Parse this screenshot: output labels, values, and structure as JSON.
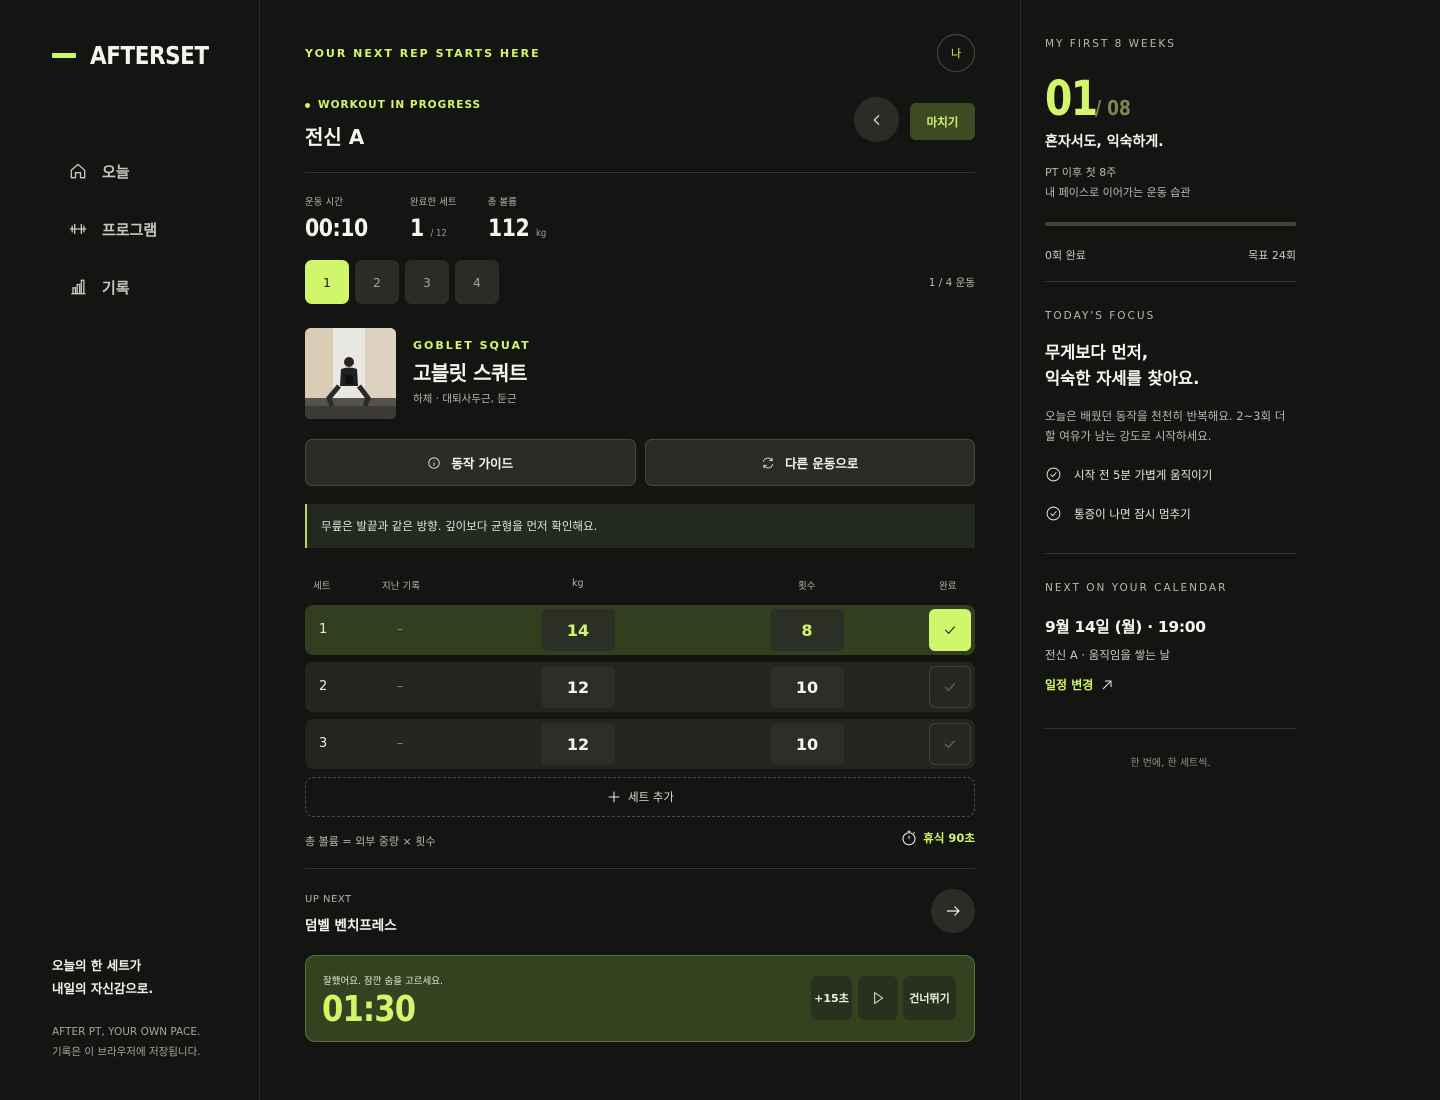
{
  "brand": {
    "name": "AFTERSET"
  },
  "colors": {
    "accent": "#d1f56b",
    "background": "#141512",
    "surface": "#2a2c27",
    "done_row": "#323f1f"
  },
  "sidebar": {
    "items": [
      {
        "label": "오늘",
        "icon": "home-icon"
      },
      {
        "label": "프로그램",
        "icon": "dumbbell-icon"
      },
      {
        "label": "기록",
        "icon": "bar-chart-icon"
      }
    ],
    "slogan_line1": "오늘의 한 세트가",
    "slogan_line2": "내일의 자신감으로.",
    "meta_line1": "AFTER PT, YOUR OWN PACE.",
    "meta_line2": "기록은 이 브라우저에 저장됩니다."
  },
  "header": {
    "tagline": "YOUR NEXT REP STARTS HERE",
    "avatar_label": "나"
  },
  "workout": {
    "status": "WORKOUT IN PROGRESS",
    "title": "전신 A",
    "finish_label": "마치기",
    "stats": [
      {
        "label": "운동 시간",
        "value": "00:10",
        "unit": ""
      },
      {
        "label": "완료한 세트",
        "value": "1",
        "unit": "/ 12"
      },
      {
        "label": "총 볼륨",
        "value": "112",
        "unit": "kg"
      }
    ],
    "exercise_tabs": [
      "1",
      "2",
      "3",
      "4"
    ],
    "active_tab": 1,
    "tab_count": "1 / 4 운동"
  },
  "exercise": {
    "name_en": "GOBLET SQUAT",
    "name_ko": "고블릿 스쿼트",
    "muscles": "하체 · 대퇴사두근, 둔근",
    "guide_label": "동작 가이드",
    "swap_label": "다른 운동으로",
    "tip": "무릎은 발끝과 같은 방향. 깊이보다 균형을 먼저 확인해요."
  },
  "sets": {
    "headers": {
      "set": "세트",
      "prev": "지난 기록",
      "kg": "kg",
      "reps": "횟수",
      "done": "완료"
    },
    "rows": [
      {
        "num": "1",
        "prev": "–",
        "kg": "14",
        "reps": "8",
        "done": true
      },
      {
        "num": "2",
        "prev": "–",
        "kg": "12",
        "reps": "10",
        "done": false
      },
      {
        "num": "3",
        "prev": "–",
        "kg": "12",
        "reps": "10",
        "done": false
      }
    ],
    "add_label": "세트 추가",
    "volume_note": "총 볼륨 = 외부 중량 × 횟수",
    "rest_label": "휴식 90초"
  },
  "up_next": {
    "label": "UP NEXT",
    "name": "덤벨 벤치프레스"
  },
  "timer": {
    "message": "잘했어요. 잠깐 숨을 고르세요.",
    "value": "01:30",
    "plus_label": "+15초",
    "skip_label": "건너뛰기"
  },
  "program": {
    "eyebrow": "MY FIRST 8 WEEKS",
    "week_current": "01",
    "week_total": "/ 08",
    "headline": "혼자서도, 익숙하게.",
    "sub_line1": "PT 이후 첫 8주",
    "sub_line2": "내 페이스로 이어가는 운동 습관",
    "progress_fraction": 0,
    "done_label": "0회 완료",
    "goal_label": "목표 24회"
  },
  "focus": {
    "eyebrow": "TODAY'S FOCUS",
    "title_line1": "무게보다 먼저,",
    "title_line2": "익숙한 자세를 찾아요.",
    "description": "오늘은 배웠던 동작을 천천히 반복해요. 2~3회 더 할 여유가 남는 강도로 시작하세요.",
    "checklist": [
      "시작 전 5분 가볍게 움직이기",
      "통증이 나면 잠시 멈추기"
    ]
  },
  "calendar": {
    "eyebrow": "NEXT ON YOUR CALENDAR",
    "date": "9월 14일 (월) · 19:00",
    "description": "전신 A · 움직임을 쌓는 날",
    "change_label": "일정 변경"
  },
  "footer_note": "한 번에, 한 세트씩."
}
